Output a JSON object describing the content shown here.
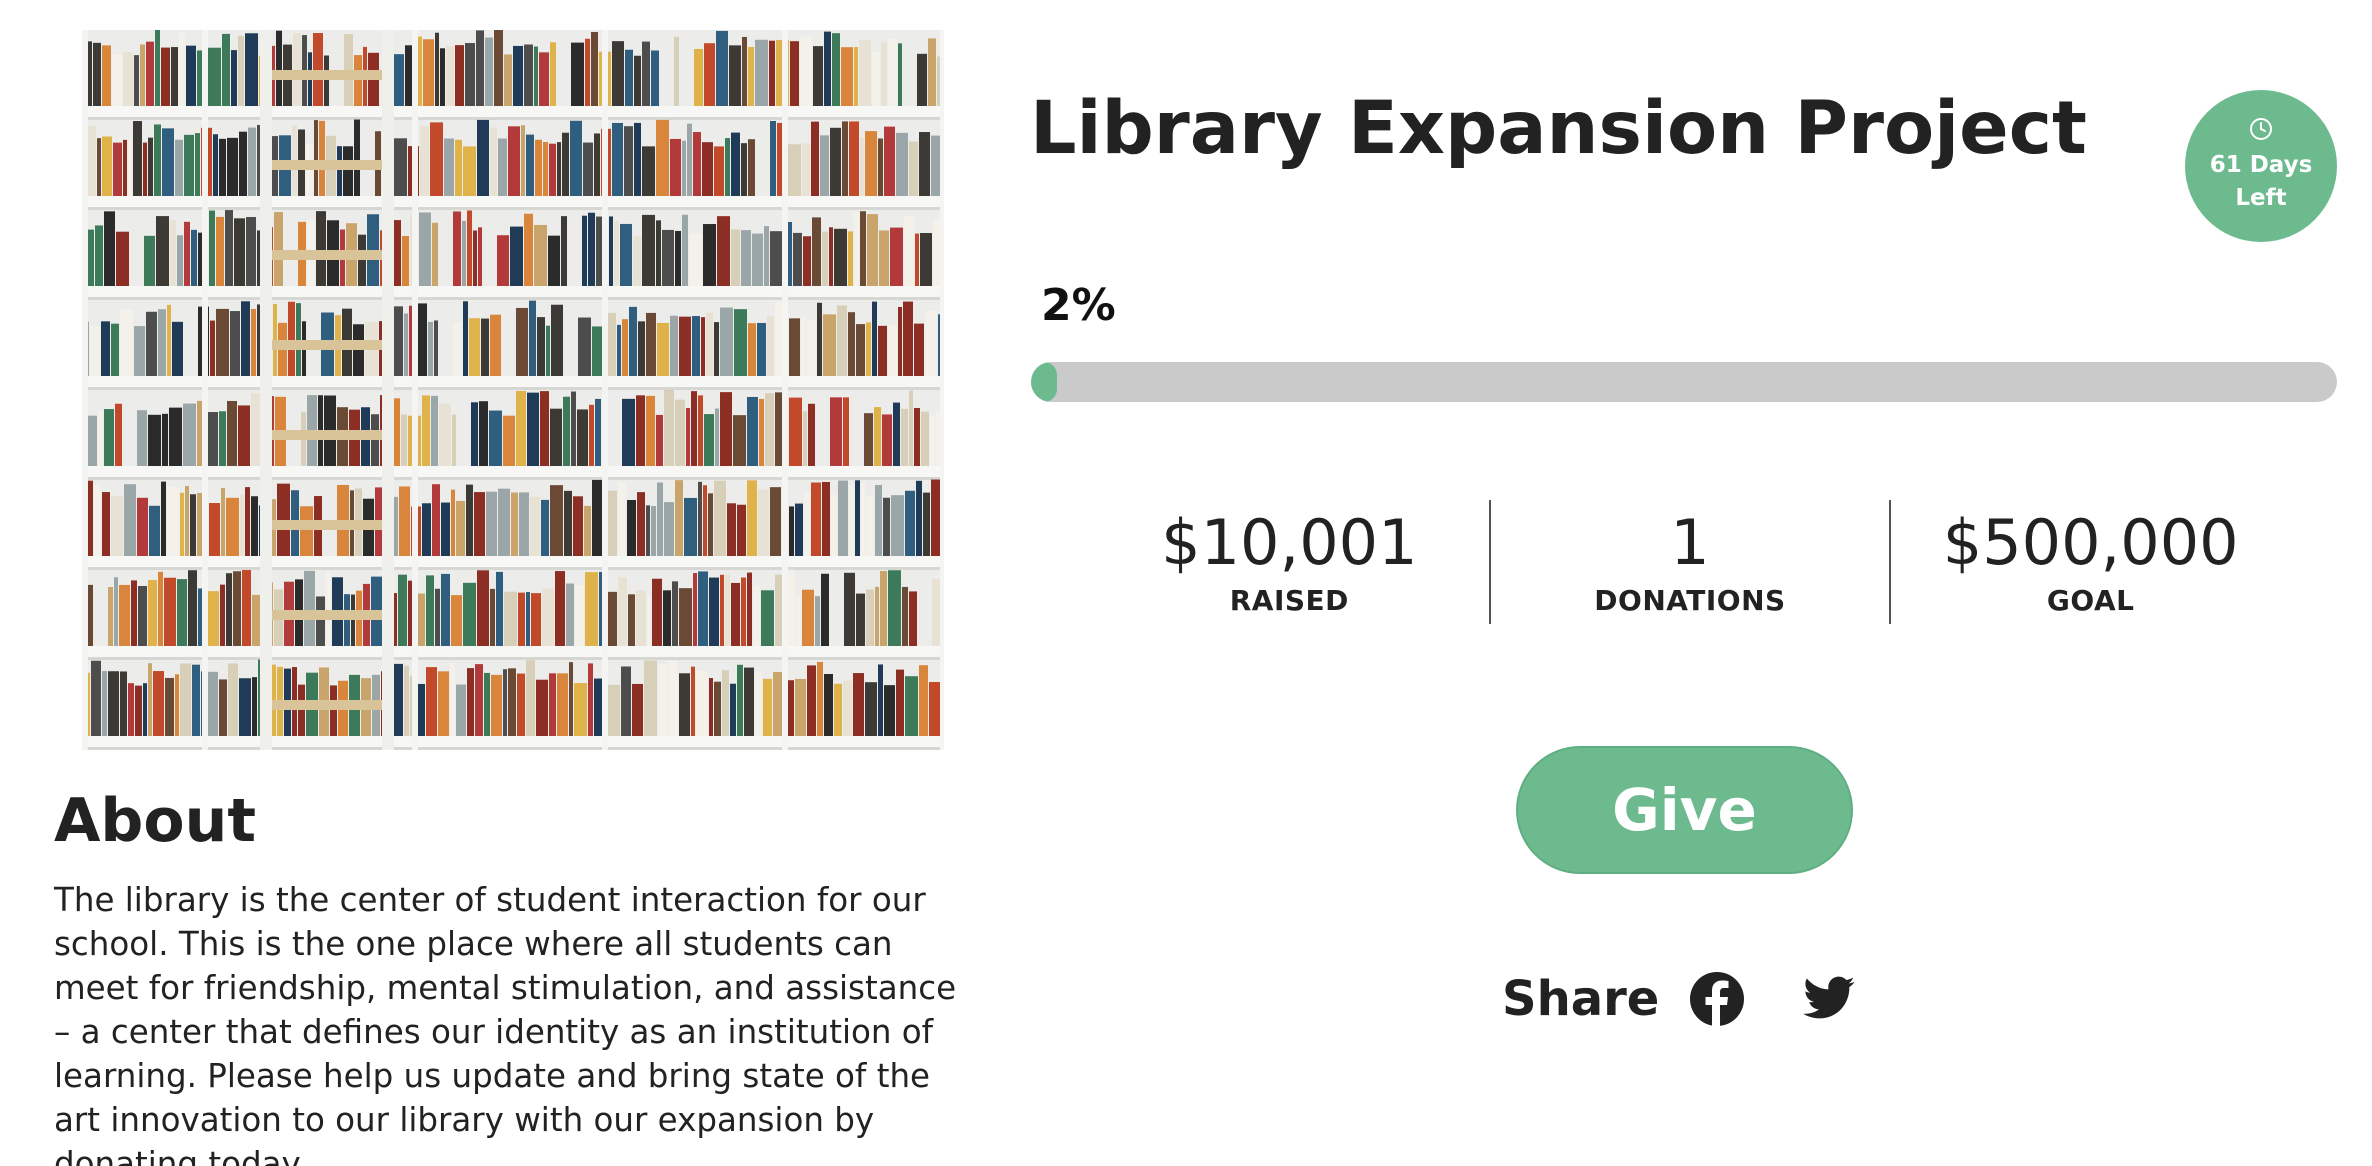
{
  "about": {
    "heading": "About",
    "text": "The library is the center of student interaction for our school. This is the one place where all students can meet for friendship, mental stimulation, and assistance – a center that defines our identity as an institution of learning. Please help us update and bring state of the art innovation to our library with our expansion by donating today."
  },
  "campaign": {
    "title": "Library Expansion Project",
    "days_left": "61 Days Left",
    "percent_label": "2%",
    "progress_fraction": 0.02
  },
  "stats": [
    {
      "value": "$10,001",
      "label": "RAISED"
    },
    {
      "value": "1",
      "label": "DONATIONS"
    },
    {
      "value": "$500,000",
      "label": "GOAL"
    }
  ],
  "give_label": "Give",
  "share": {
    "label": "Share",
    "icons": [
      "facebook-icon",
      "twitter-icon"
    ]
  },
  "colors": {
    "accent": "#6dba8f",
    "track": "#cacaca",
    "text": "#222222"
  }
}
